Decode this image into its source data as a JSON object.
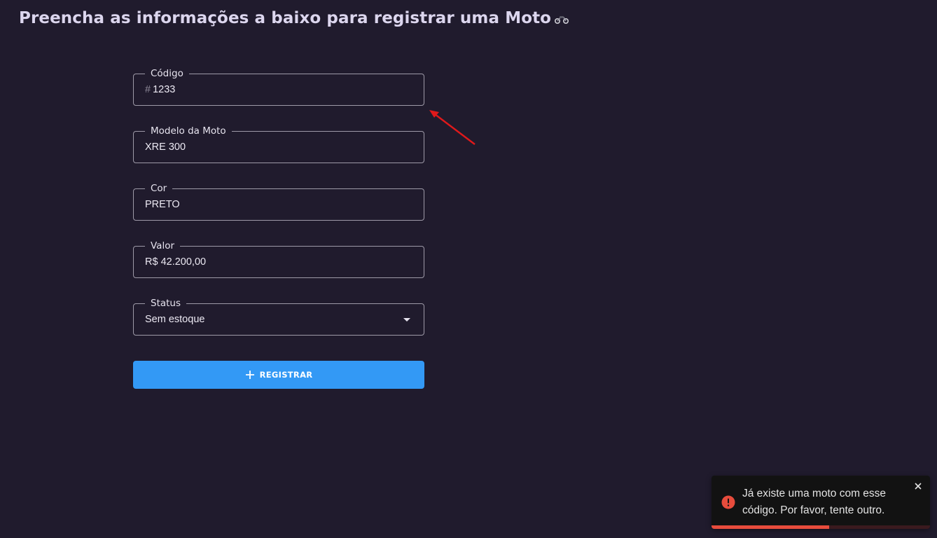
{
  "header": {
    "title": "Preencha as informações a baixo para registrar uma Moto",
    "title_icon": "motorcycle-icon"
  },
  "form": {
    "codigo": {
      "label": "Código",
      "value": "1233",
      "icon": "hash-icon",
      "icon_glyph": "#"
    },
    "modelo": {
      "label": "Modelo da Moto",
      "value": "XRE 300"
    },
    "cor": {
      "label": "Cor",
      "value": "PRETO"
    },
    "valor": {
      "label": "Valor",
      "value": "R$ 42.200,00"
    },
    "status": {
      "label": "Status",
      "value": "Sem estoque"
    },
    "submit_label": "REGISTRAR"
  },
  "toast": {
    "type": "error",
    "message": "Já existe uma moto com esse código. Por favor, tente outro.",
    "progress": 0.54
  },
  "colors": {
    "background": "#201b2d",
    "button": "#3399f5",
    "error": "#e74c3c",
    "annotation": "#e0191b"
  }
}
